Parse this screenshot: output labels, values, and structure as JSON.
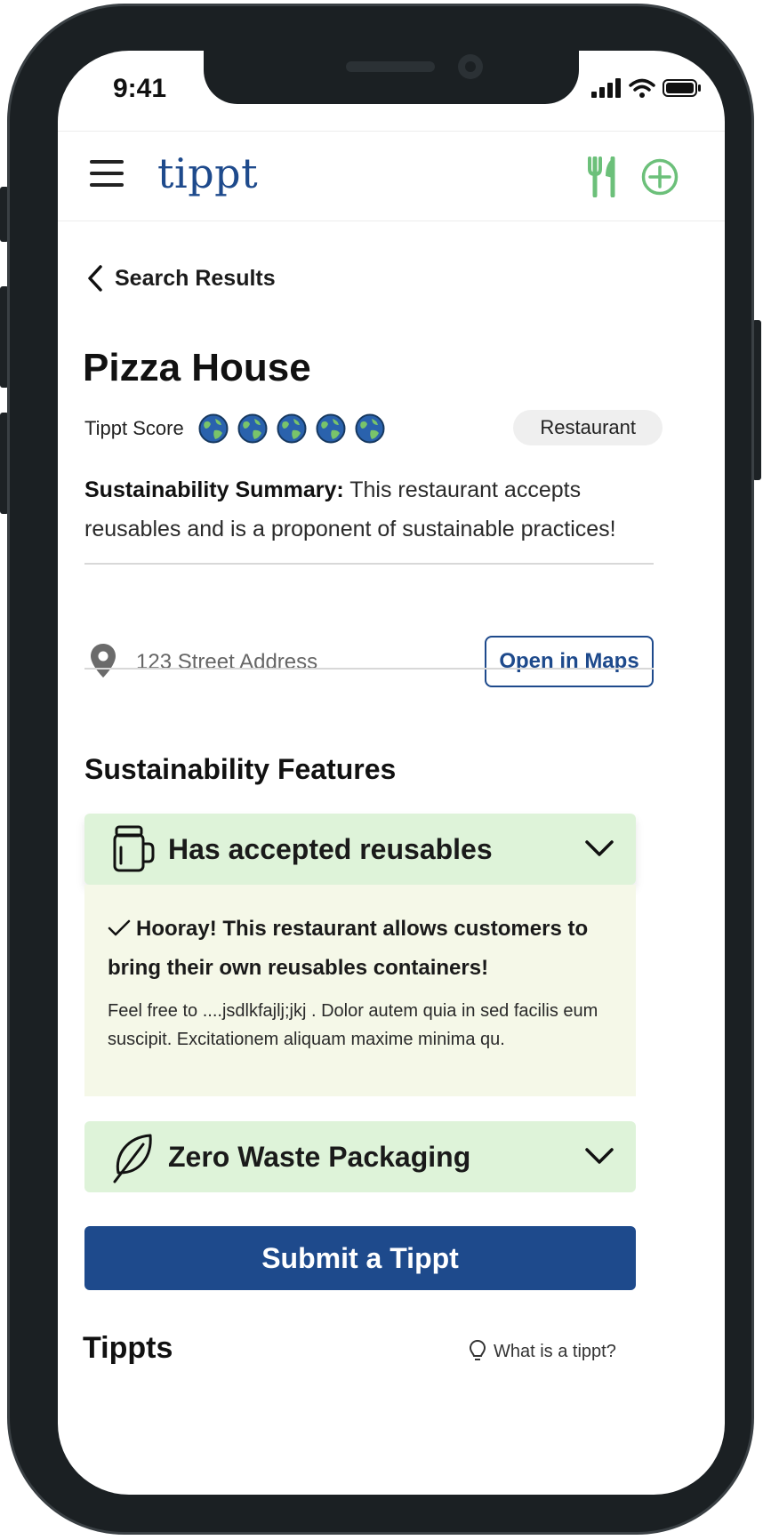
{
  "status_bar": {
    "time": "9:41"
  },
  "app_bar": {
    "logo": "tippt"
  },
  "nav": {
    "back_label": "Search Results"
  },
  "place": {
    "name": "Pizza House",
    "score_label": "Tippt Score",
    "score": 5,
    "category": "Restaurant",
    "summary_label": "Sustainability Summary:",
    "summary_text": " This restaurant accepts reusables and is a proponent of sustainable practices!",
    "address": "123 Street Address",
    "maps_button": "Open in Maps"
  },
  "features": {
    "heading": "Sustainability Features",
    "items": [
      {
        "title": "Has accepted reusables",
        "icon": "mug-icon",
        "expanded": true,
        "body_heading": "Hooray! This restaurant allows customers to bring their own reusables containers!",
        "body_text": "Feel free to ....jsdlkfajlj;jkj . Dolor autem quia in sed facilis eum suscipit. Excitationem aliquam maxime minima qu."
      },
      {
        "title": "Zero Waste Packaging",
        "icon": "leaf-icon",
        "expanded": false
      }
    ]
  },
  "submit_button": "Submit a Tippt",
  "tippts": {
    "heading": "Tippts",
    "help_link": "What is a tippt?"
  },
  "colors": {
    "brand": "#1e4a8c",
    "accent_green": "#6cc07a",
    "feature_bg": "#def3d9",
    "feature_body_bg": "#f5f8e8"
  }
}
